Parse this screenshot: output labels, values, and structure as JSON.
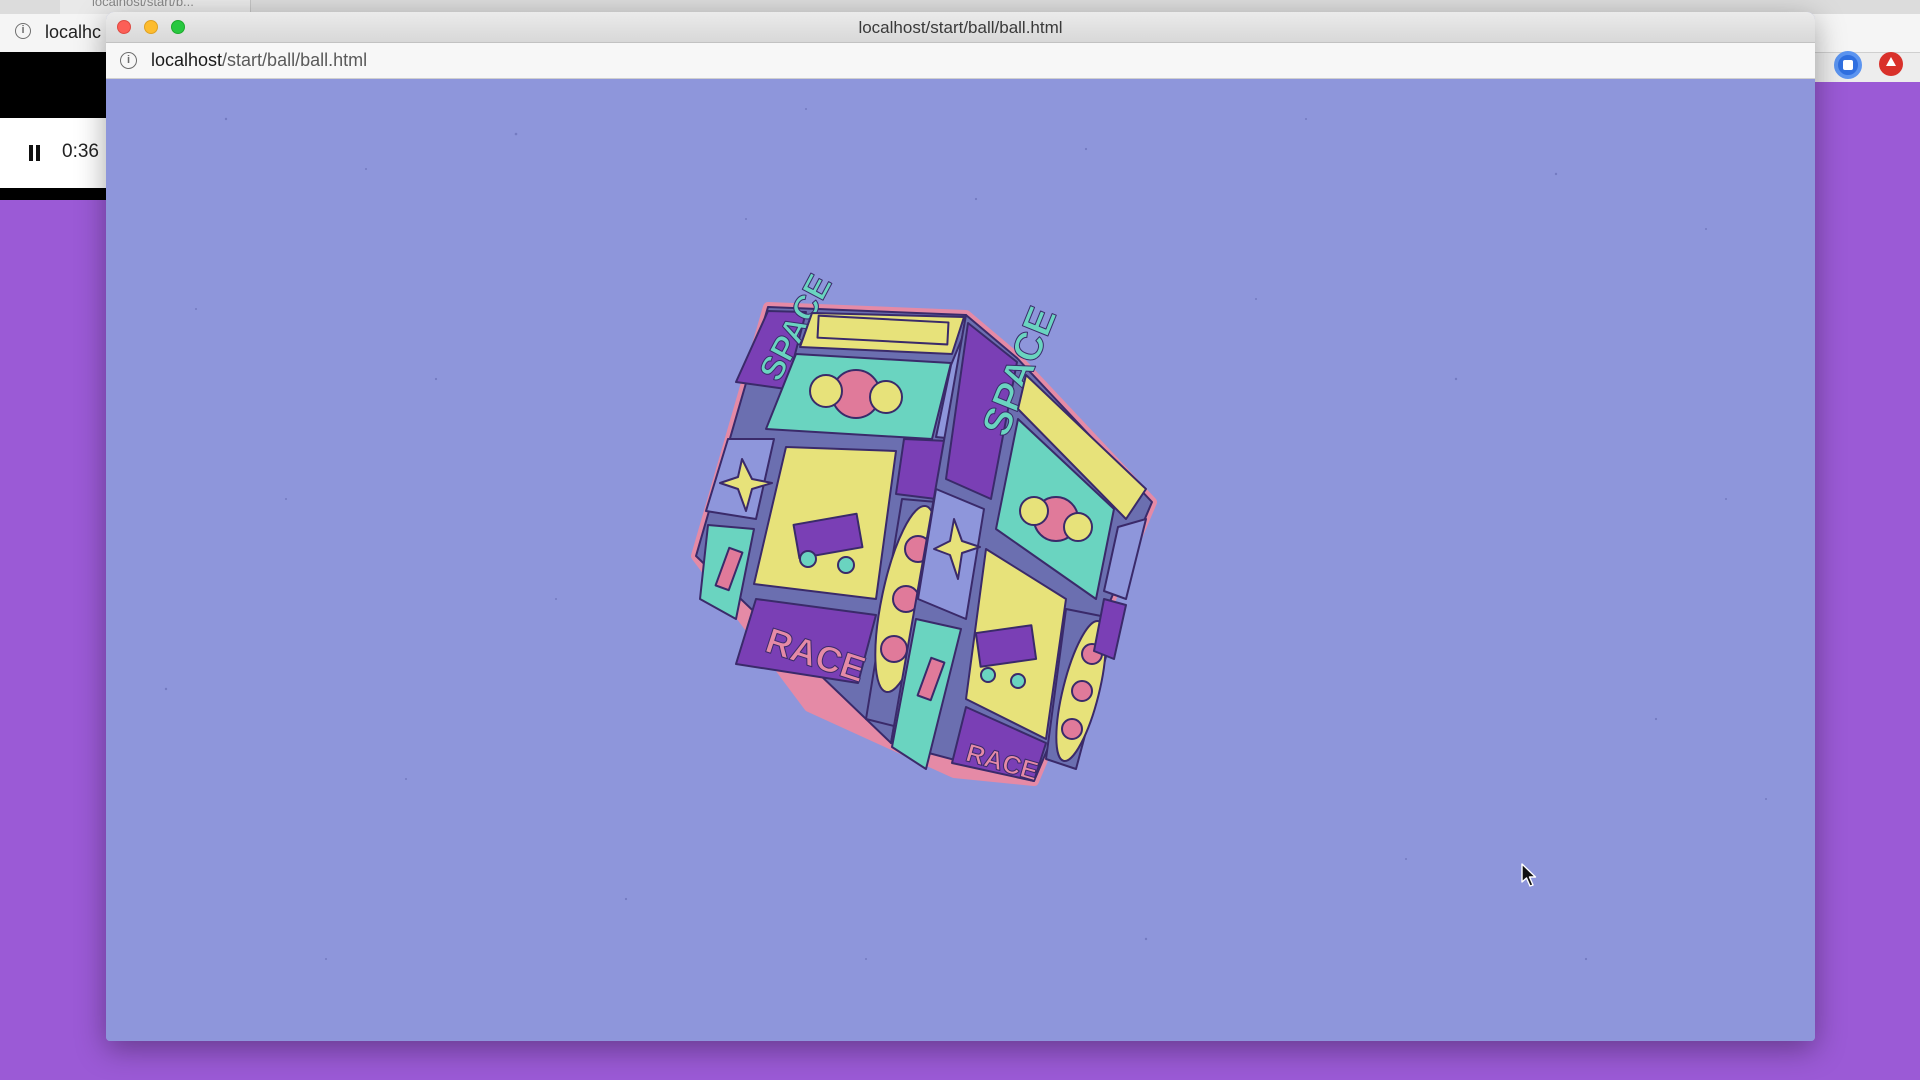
{
  "background_window": {
    "tab_label": "localhost/start/b...",
    "url_text": "localhc"
  },
  "media_control": {
    "time": "0:36",
    "state_icon": "pause-icon"
  },
  "window": {
    "title": "localhost/start/ball/ball.html",
    "url_host": "localhost",
    "url_path": "/start/ball/ball.html"
  },
  "scene": {
    "background_color": "#8e96db",
    "object": "cube",
    "texture_text": {
      "top_left": "SPACE",
      "top_right": "SPACE",
      "bottom_left": "RACE",
      "bottom_right": "RACE"
    },
    "palette": {
      "border": "#e58aa6",
      "teal": "#6ad4c0",
      "yellow": "#e7e27a",
      "purple": "#7a3fb5",
      "slate": "#6b6fb0",
      "pink": "#e07a9a",
      "outline": "#3a2a6a"
    }
  },
  "extensions": [
    "blue-extension-icon",
    "red-extension-icon"
  ]
}
